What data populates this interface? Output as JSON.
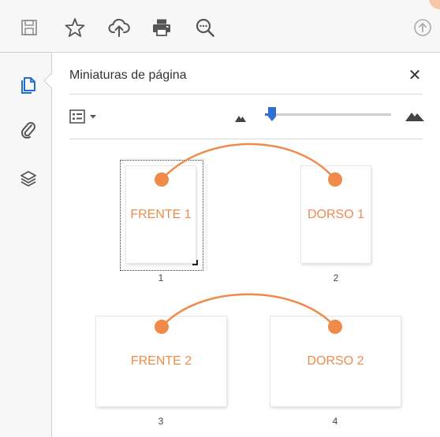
{
  "colors": {
    "accent_orange": "#F08A4B",
    "slider_blue": "#2F6FD0",
    "icon_gray": "#555555",
    "blue_icon": "#1F6FD0"
  },
  "toolbar": {
    "icons": [
      "save-icon",
      "star-icon",
      "cloud-upload-icon",
      "print-icon",
      "zoom-out-icon",
      "upload-arrow-icon"
    ]
  },
  "leftrail": {
    "icons": [
      "page-thumbnails-icon",
      "attachment-icon",
      "layers-icon"
    ]
  },
  "panel": {
    "title": "Miniaturas de página",
    "close_label": "✕",
    "zoom_slider_level": 0.05
  },
  "thumbnails": [
    {
      "label": "FRENTE 1",
      "page_number": "1",
      "selected": true
    },
    {
      "label": "DORSO 1",
      "page_number": "2",
      "selected": false
    },
    {
      "label": "FRENTE 2",
      "page_number": "3",
      "selected": false
    },
    {
      "label": "DORSO 2",
      "page_number": "4",
      "selected": false
    }
  ]
}
